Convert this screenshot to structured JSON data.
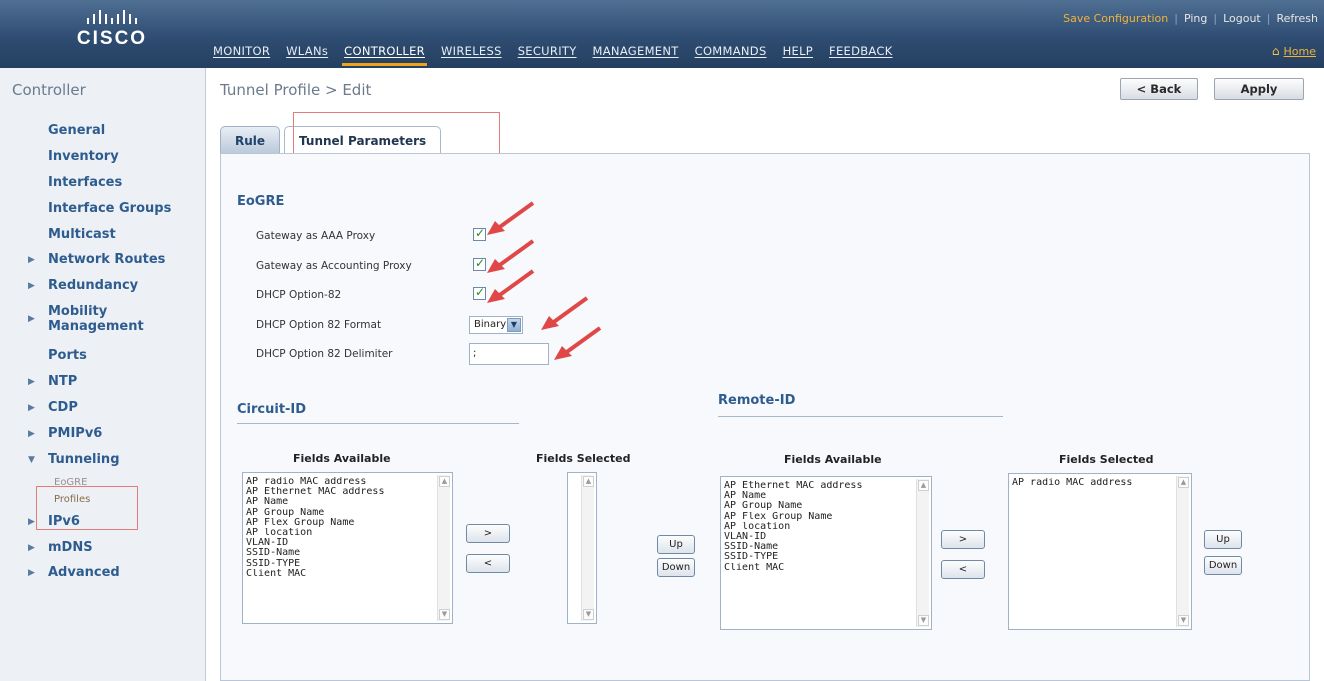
{
  "brand": {
    "logo_text": "CISCO"
  },
  "header": {
    "top_links": [
      "Save Configuration",
      "Ping",
      "Logout",
      "Refresh"
    ],
    "home_label": "Home",
    "nav": [
      {
        "label": "MONITOR"
      },
      {
        "label": "WLANs"
      },
      {
        "label": "CONTROLLER",
        "active": true
      },
      {
        "label": "WIRELESS"
      },
      {
        "label": "SECURITY"
      },
      {
        "label": "MANAGEMENT"
      },
      {
        "label": "COMMANDS"
      },
      {
        "label": "HELP"
      },
      {
        "label": "FEEDBACK"
      }
    ]
  },
  "sidebar": {
    "title": "Controller",
    "items": [
      {
        "label": "General"
      },
      {
        "label": "Inventory"
      },
      {
        "label": "Interfaces"
      },
      {
        "label": "Interface Groups"
      },
      {
        "label": "Multicast"
      },
      {
        "label": "Network Routes",
        "expandable": true
      },
      {
        "label": "Redundancy",
        "expandable": true
      },
      {
        "label": "Mobility Management",
        "expandable": true
      },
      {
        "label": "Ports"
      },
      {
        "label": "NTP",
        "expandable": true
      },
      {
        "label": "CDP",
        "expandable": true
      },
      {
        "label": "PMIPv6",
        "expandable": true
      },
      {
        "label": "Tunneling",
        "expanded": true
      },
      {
        "label": "IPv6",
        "expandable": true
      },
      {
        "label": "mDNS",
        "expandable": true
      },
      {
        "label": "Advanced",
        "expandable": true
      }
    ],
    "tunneling_sub": [
      "EoGRE",
      "Profiles"
    ]
  },
  "page": {
    "title": "Tunnel Profile > Edit",
    "back_label": "< Back",
    "apply_label": "Apply",
    "tabs": [
      "Rule",
      "Tunnel Parameters"
    ]
  },
  "eogre": {
    "title": "EoGRE",
    "gateway_aaa_label": "Gateway as AAA Proxy",
    "gateway_aaa_checked": true,
    "gateway_accounting_label": "Gateway as Accounting Proxy",
    "gateway_accounting_checked": true,
    "dhcp82_label": "DHCP Option-82",
    "dhcp82_checked": true,
    "dhcp82_format_label": "DHCP Option 82 Format",
    "dhcp82_format_value": "Binary",
    "dhcp82_delim_label": "DHCP Option 82 Delimiter",
    "dhcp82_delim_value": ";"
  },
  "circuit": {
    "title": "Circuit-ID",
    "available_header": "Fields Available",
    "selected_header": "Fields Selected",
    "available": [
      "AP radio MAC address",
      "AP Ethernet MAC address",
      "AP Name",
      "AP Group Name",
      "AP Flex Group Name",
      "AP location",
      "VLAN-ID",
      "SSID-Name",
      "SSID-TYPE",
      "Client MAC"
    ],
    "selected": [],
    "add_label": ">",
    "remove_label": "<",
    "up_label": "Up",
    "down_label": "Down"
  },
  "remote": {
    "title": "Remote-ID",
    "available_header": "Fields Available",
    "selected_header": "Fields Selected",
    "available": [
      "AP Ethernet MAC address",
      "AP Name",
      "AP Group Name",
      "AP Flex Group Name",
      "AP location",
      "VLAN-ID",
      "SSID-Name",
      "SSID-TYPE",
      "Client MAC"
    ],
    "selected": [
      "AP radio MAC address"
    ],
    "add_label": ">",
    "remove_label": "<",
    "up_label": "Up",
    "down_label": "Down"
  },
  "colors": {
    "header_bg": "#2f4d72",
    "accent": "#f0a31a",
    "link_orange": "#f0b43a",
    "sidebar_link": "#2f5c8f",
    "annotation_red": "#e04848",
    "check_green": "#1c8a2b"
  }
}
